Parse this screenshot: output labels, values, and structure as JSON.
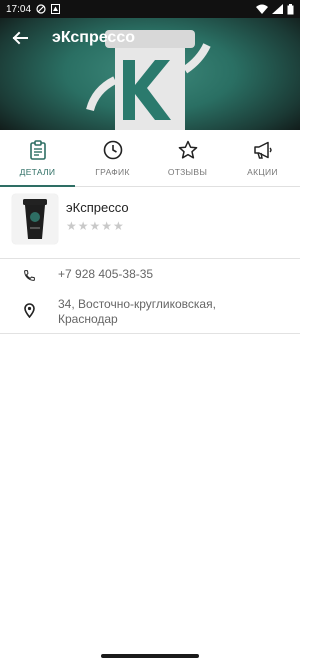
{
  "status": {
    "time": "17:04"
  },
  "header": {
    "title": "эКспрессо"
  },
  "tabs": [
    {
      "label": "ДЕТАЛИ",
      "icon": "clipboard-icon",
      "active": true
    },
    {
      "label": "ГРАФИК",
      "icon": "clock-icon",
      "active": false
    },
    {
      "label": "ОТЗЫВЫ",
      "icon": "star-icon",
      "active": false
    },
    {
      "label": "АКЦИИ",
      "icon": "megaphone-icon",
      "active": false
    }
  ],
  "place": {
    "name": "эКспрессо",
    "rating_stars": "★★★★★"
  },
  "contact": {
    "phone": "+7 928 405-38-35",
    "address_line1": "34, Восточно-кругликовская,",
    "address_line2": "Краснодар"
  },
  "colors": {
    "accent": "#2e6e64",
    "hero": "#2a6f63"
  }
}
